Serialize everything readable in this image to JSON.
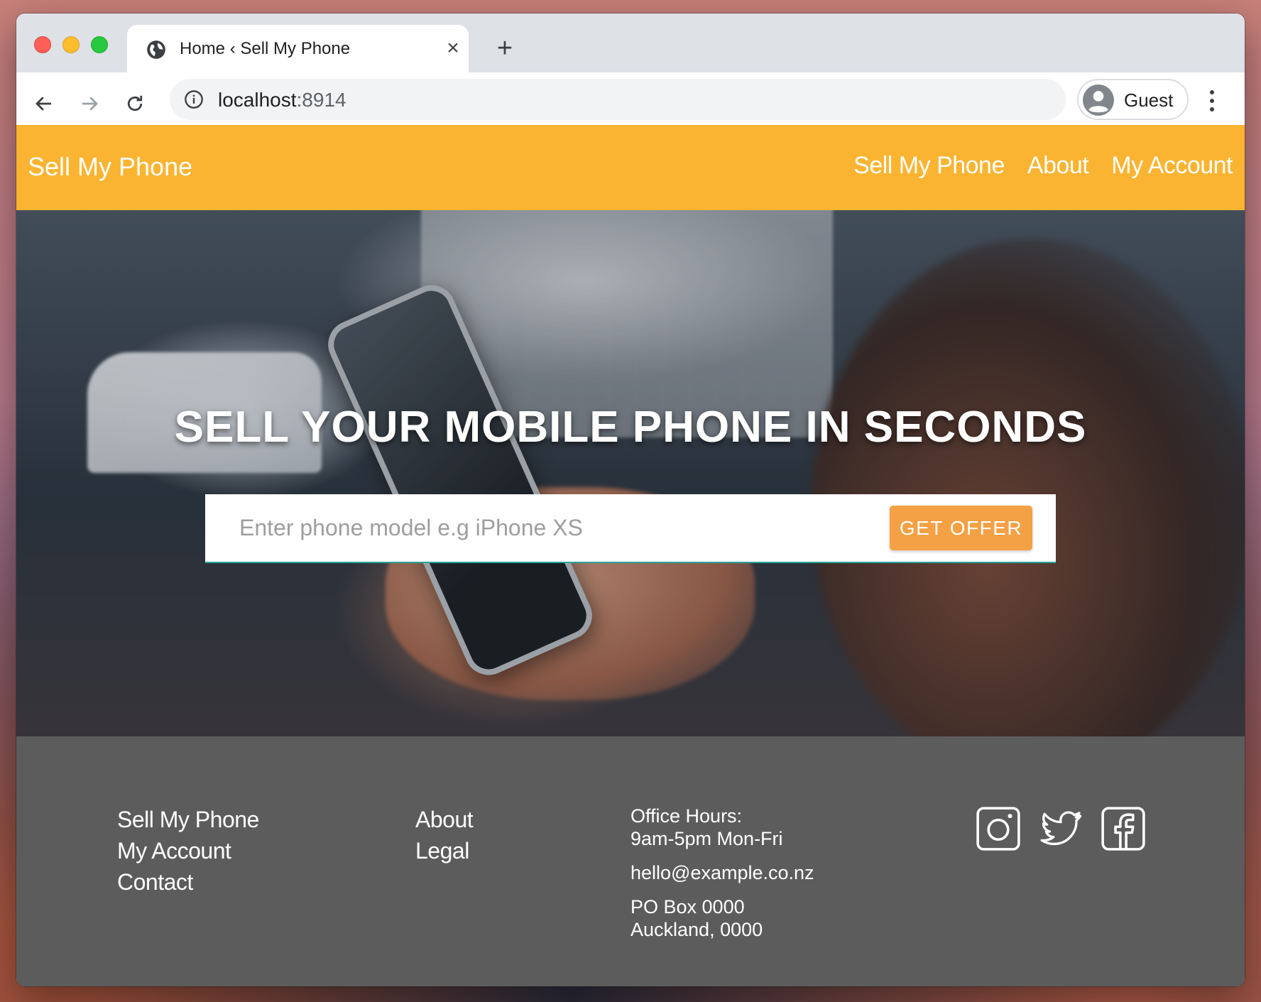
{
  "browser": {
    "tab_title": "Home ‹ Sell My Phone",
    "url_host": "localhost",
    "url_port": ":8914",
    "profile_name": "Guest"
  },
  "site_nav": {
    "brand": "Sell My Phone",
    "links": [
      {
        "label": "Sell My Phone"
      },
      {
        "label": "About"
      },
      {
        "label": "My Account"
      }
    ],
    "bg_color": "#fbb431"
  },
  "hero": {
    "title": "SELL YOUR MOBILE PHONE IN SECONDS",
    "search_placeholder": "Enter phone model e.g iPhone XS",
    "search_value": "",
    "button_label": "GET OFFER",
    "button_color": "#f4a044"
  },
  "footer": {
    "col1": [
      {
        "label": "Sell My Phone"
      },
      {
        "label": "My Account"
      },
      {
        "label": "Contact"
      }
    ],
    "col2": [
      {
        "label": "About"
      },
      {
        "label": "Legal"
      }
    ],
    "contact": {
      "hours_label": "Office Hours:",
      "hours": "9am-5pm Mon-Fri",
      "email": "hello@example.co.nz",
      "address_line1": "PO Box 0000",
      "address_line2": "Auckland, 0000"
    },
    "social": [
      {
        "icon": "instagram-icon"
      },
      {
        "icon": "twitter-icon"
      },
      {
        "icon": "facebook-icon"
      }
    ],
    "bg_color": "#5c5c5c"
  }
}
